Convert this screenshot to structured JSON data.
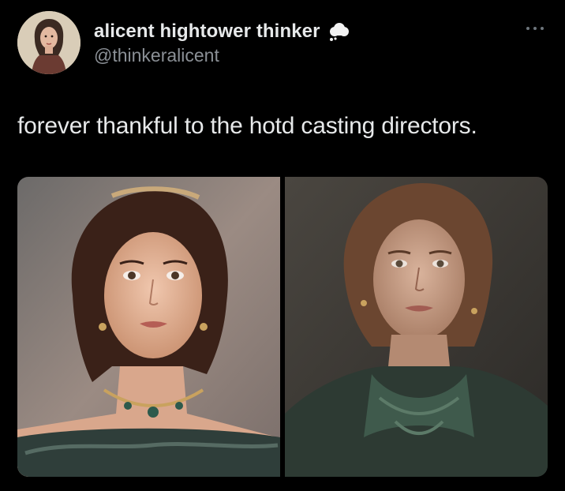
{
  "author": {
    "display_name": "alicent hightower thinker",
    "handle": "@thinkeralicent",
    "badge_icon": "cloud-icon",
    "avatar_icon": "profile-avatar"
  },
  "menu": {
    "icon": "more-options-icon"
  },
  "tweet": {
    "text": "forever thankful to the hotd casting directors."
  },
  "media": {
    "images": [
      {
        "name": "portrait-left",
        "description_icon": "photo"
      },
      {
        "name": "portrait-right",
        "description_icon": "photo"
      }
    ]
  },
  "colors": {
    "background": "#000000",
    "text_primary": "#e7e9ea",
    "text_secondary": "#8b9096"
  }
}
